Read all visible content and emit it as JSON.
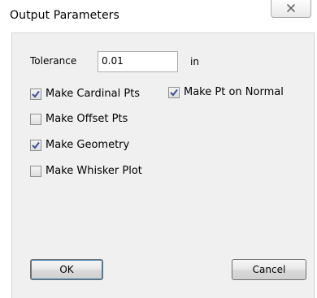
{
  "window": {
    "title": "Output Parameters"
  },
  "tolerance": {
    "label": "Tolerance",
    "value": "0.01",
    "unit": "in"
  },
  "options": {
    "cardinal": {
      "label": "Make Cardinal Pts",
      "checked": true
    },
    "normal": {
      "label": "Make Pt on Normal",
      "checked": true
    },
    "offset": {
      "label": "Make Offset Pts",
      "checked": false
    },
    "geometry": {
      "label": "Make Geometry",
      "checked": true
    },
    "whisker": {
      "label": "Make Whisker Plot",
      "checked": false
    }
  },
  "buttons": {
    "ok": "OK",
    "cancel": "Cancel"
  },
  "icons": {
    "close": "close-icon",
    "check": "checkmark-icon"
  },
  "colors": {
    "checkmark": "#3d4c99",
    "client_bg": "#f0f0f0"
  }
}
